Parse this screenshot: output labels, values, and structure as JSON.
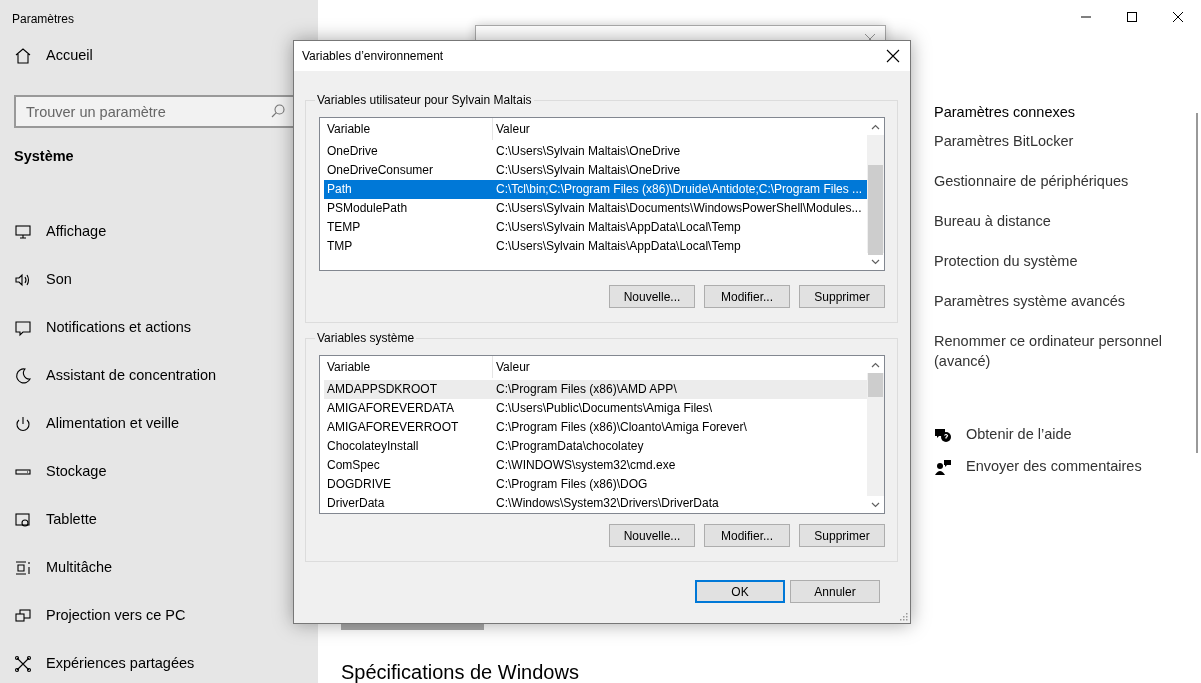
{
  "settings_window": {
    "title": "Paramètres",
    "home": "Accueil",
    "search": {
      "placeholder": "Trouver un paramètre"
    },
    "section": "Système",
    "nav_items": [
      {
        "label": "Affichage",
        "kind": "display"
      },
      {
        "label": "Son",
        "kind": "sound"
      },
      {
        "label": "Notifications et actions",
        "kind": "notifications"
      },
      {
        "label": "Assistant de concentration",
        "kind": "focus"
      },
      {
        "label": "Alimentation et veille",
        "kind": "power"
      },
      {
        "label": "Stockage",
        "kind": "storage"
      },
      {
        "label": "Tablette",
        "kind": "tablet"
      },
      {
        "label": "Multitâche",
        "kind": "multitask"
      },
      {
        "label": "Projection vers ce PC",
        "kind": "projection"
      },
      {
        "label": "Expériences partagées",
        "kind": "shared"
      }
    ],
    "related": {
      "heading": "Paramètres connexes",
      "links": [
        "Paramètres BitLocker",
        "Gestionnaire de périphériques",
        "Bureau à distance",
        "Protection du système",
        "Paramètres système avancés",
        "Renommer ce ordinateur personnel (avancé)"
      ]
    },
    "help_links": [
      {
        "label": "Obtenir de l’aide",
        "kind": "help"
      },
      {
        "label": "Envoyer des commentaires",
        "kind": "feedback"
      }
    ],
    "bottom_heading": "Spécifications de Windows"
  },
  "dialog": {
    "title": "Variables d’environnement",
    "groups": [
      {
        "label": "Variables utilisateur pour Sylvain Maltais",
        "focused": true,
        "columns": [
          "Variable",
          "Valeur"
        ],
        "rows": [
          {
            "variable": "OneDrive",
            "value": "C:\\Users\\Sylvain Maltais\\OneDrive",
            "selected": false
          },
          {
            "variable": "OneDriveConsumer",
            "value": "C:\\Users\\Sylvain Maltais\\OneDrive",
            "selected": false
          },
          {
            "variable": "Path",
            "value": "C:\\Tcl\\bin;C:\\Program Files (x86)\\Druide\\Antidote;C:\\Program Files ...",
            "selected": true
          },
          {
            "variable": "PSModulePath",
            "value": "C:\\Users\\Sylvain Maltais\\Documents\\WindowsPowerShell\\Modules...",
            "selected": false
          },
          {
            "variable": "TEMP",
            "value": "C:\\Users\\Sylvain Maltais\\AppData\\Local\\Temp",
            "selected": false
          },
          {
            "variable": "TMP",
            "value": "C:\\Users\\Sylvain Maltais\\AppData\\Local\\Temp",
            "selected": false
          }
        ],
        "buttons": [
          "Nouvelle...",
          "Modifier...",
          "Supprimer"
        ]
      },
      {
        "label": "Variables système",
        "focused": false,
        "columns": [
          "Variable",
          "Valeur"
        ],
        "rows": [
          {
            "variable": "AMDAPPSDKROOT",
            "value": "C:\\Program Files (x86)\\AMD APP\\",
            "selected": true
          },
          {
            "variable": "AMIGAFOREVERDATA",
            "value": "C:\\Users\\Public\\Documents\\Amiga Files\\",
            "selected": false
          },
          {
            "variable": "AMIGAFOREVERROOT",
            "value": "C:\\Program Files (x86)\\Cloanto\\Amiga Forever\\",
            "selected": false
          },
          {
            "variable": "ChocolateyInstall",
            "value": "C:\\ProgramData\\chocolatey",
            "selected": false
          },
          {
            "variable": "ComSpec",
            "value": "C:\\WINDOWS\\system32\\cmd.exe",
            "selected": false
          },
          {
            "variable": "DOGDRIVE",
            "value": "C:\\Program Files (x86)\\DOG",
            "selected": false
          },
          {
            "variable": "DriverData",
            "value": "C:\\Windows\\System32\\Drivers\\DriverData",
            "selected": false
          }
        ],
        "buttons": [
          "Nouvelle...",
          "Modifier...",
          "Supprimer"
        ]
      }
    ],
    "buttons": [
      {
        "label": "OK",
        "default": true
      },
      {
        "label": "Annuler",
        "default": false
      }
    ]
  }
}
